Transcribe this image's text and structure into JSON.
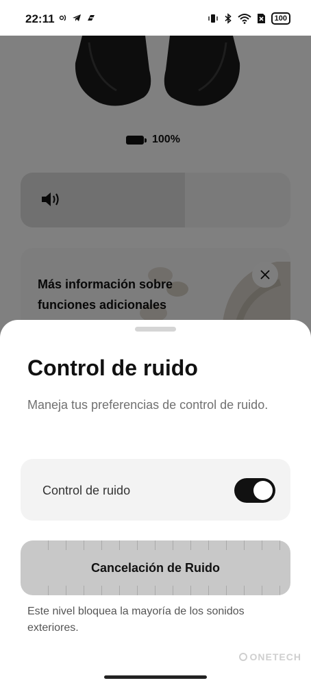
{
  "status_bar": {
    "time": "22:11",
    "battery_level": "100",
    "notification_icons": [
      "nfc-icon",
      "telegram-icon",
      "app-icon"
    ],
    "system_icons": [
      "vibrate-icon",
      "bluetooth-icon",
      "wifi-icon",
      "sim-off-icon"
    ]
  },
  "device": {
    "battery_percent": "100%"
  },
  "volume": {
    "level": 0.61,
    "icon": "speaker-icon"
  },
  "promo": {
    "text": "Más información sobre funciones adicionales",
    "close_icon": "close-icon"
  },
  "sheet": {
    "title": "Control de ruido",
    "description": "Maneja tus preferencias de control de ruido.",
    "toggle": {
      "label": "Control de ruido",
      "on": true
    },
    "mode": {
      "label": "Cancelación de Ruido",
      "description": "Este nivel bloquea la mayoría de los sonidos exteriores."
    }
  },
  "watermark": "ONETECH",
  "colors": {
    "accent": "#111111",
    "sheet_bg": "#ffffff",
    "card_bg": "#f3f3f3",
    "slider_bg": "#c8c8c8"
  }
}
